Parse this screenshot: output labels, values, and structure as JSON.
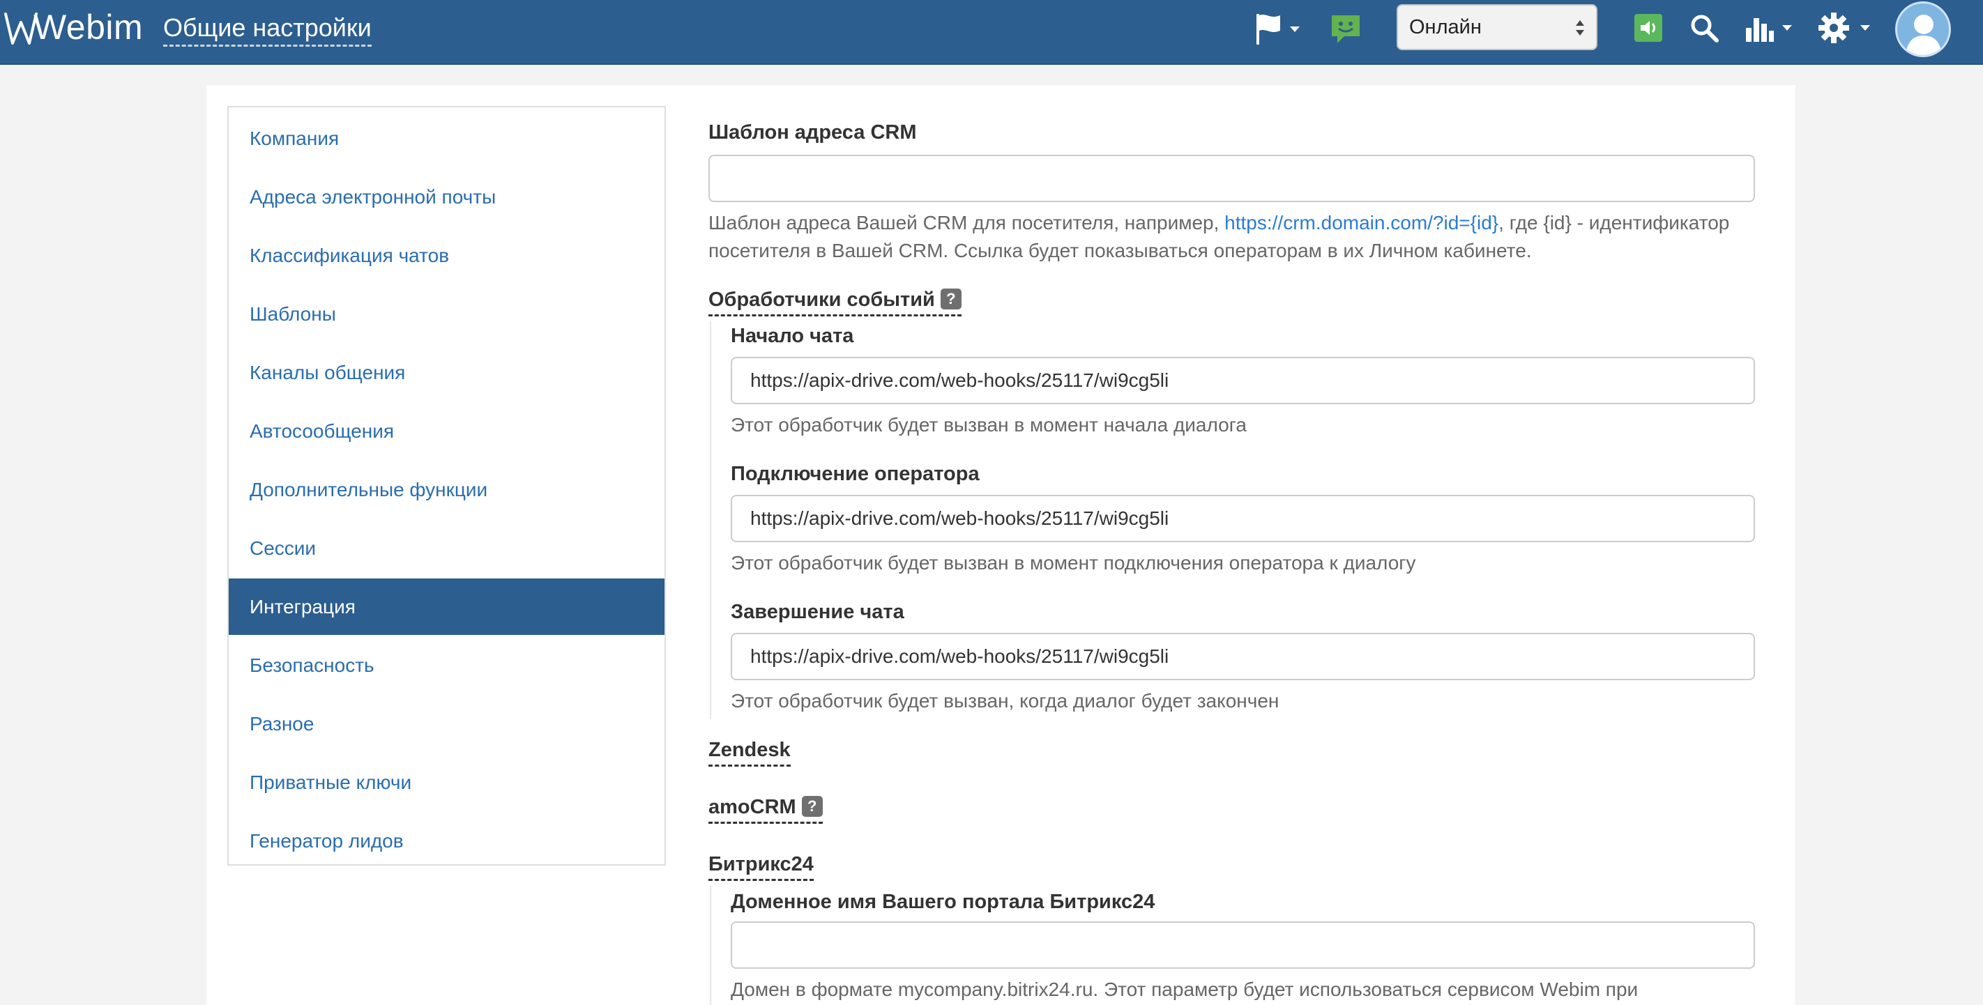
{
  "header": {
    "logo_text": "Webim",
    "page_title": "Общие настройки",
    "status_value": "Онлайн",
    "status_options": [
      "Онлайн"
    ],
    "icons": [
      "flag-icon",
      "chat-bubble-icon",
      "sound-icon",
      "search-icon",
      "stats-icon",
      "gear-icon",
      "user-avatar-icon"
    ],
    "accent_color": "#2c5e8f",
    "green_color": "#5cb85c"
  },
  "sidebar": {
    "active_index": 8,
    "items": [
      {
        "label": "Компания"
      },
      {
        "label": "Адреса электронной почты"
      },
      {
        "label": "Классификация чатов"
      },
      {
        "label": "Шаблоны"
      },
      {
        "label": "Каналы общения"
      },
      {
        "label": "Автосообщения"
      },
      {
        "label": "Дополнительные функции"
      },
      {
        "label": "Сессии"
      },
      {
        "label": "Интеграция"
      },
      {
        "label": "Безопасность"
      },
      {
        "label": "Разное"
      },
      {
        "label": "Приватные ключи"
      },
      {
        "label": "Генератор лидов"
      }
    ]
  },
  "crm": {
    "label": "Шаблон адреса CRM",
    "value": "",
    "help_before": "Шаблон адреса Вашей CRM для посетителя, например, ",
    "help_link": "https://crm.domain.com/?id={id}",
    "help_after": ", где {id} - идентификатор",
    "help_line2": "посетителя в Вашей CRM. Ссылка будет показываться операторам в их Личном кабинете."
  },
  "events": {
    "section_label": "Обработчики событий",
    "help_badge": "?",
    "chat_start": {
      "label": "Начало чата",
      "value": "https://apix-drive.com/web-hooks/25117/wi9cg5li",
      "help": "Этот обработчик будет вызван в момент начала диалога"
    },
    "operator_connect": {
      "label": "Подключение оператора",
      "value": "https://apix-drive.com/web-hooks/25117/wi9cg5li",
      "help": "Этот обработчик будет вызван в момент подключения оператора к диалогу"
    },
    "chat_end": {
      "label": "Завершение чата",
      "value": "https://apix-drive.com/web-hooks/25117/wi9cg5li",
      "help": "Этот обработчик будет вызван, когда диалог будет закончен"
    }
  },
  "zendesk": {
    "label": "Zendesk"
  },
  "amocrm": {
    "label": "amoCRM",
    "help_badge": "?"
  },
  "bitrix": {
    "section_label": "Битрикс24",
    "domain_label": "Доменное имя Вашего портала Битрикс24",
    "domain_value": "",
    "help": "Домен в формате mycompany.bitrix24.ru. Этот параметр будет использоваться сервисом Webim при"
  }
}
